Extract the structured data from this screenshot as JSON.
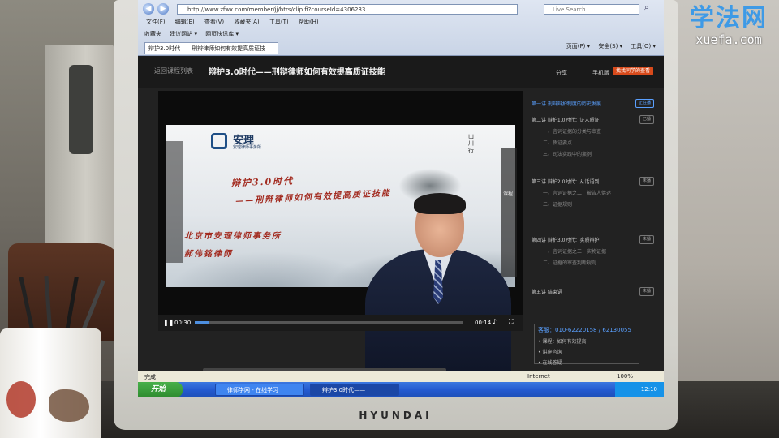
{
  "watermark": {
    "main": "学法网",
    "sub": "xuefa.com"
  },
  "monitor": {
    "brand": "HYUNDAI"
  },
  "browser": {
    "address": "http://www.zfwx.com/member/jj/btrs/clip.fi?courseId=4306233",
    "search_placeholder": "Live Search",
    "menu": [
      "文件(F)",
      "编辑(E)",
      "查看(V)",
      "收藏夹(A)",
      "工具(T)",
      "帮助(H)"
    ],
    "favorites": [
      "收藏夹",
      "建议网站 ▾",
      "网页快讯库 ▾"
    ],
    "tab_title": "辩护3.0时代——刑辩律师如何有效提高质证技",
    "commands": [
      "页面(P) ▾",
      "安全(S) ▾",
      "工具(O) ▾"
    ]
  },
  "page": {
    "return_link": "返回课程列表",
    "title": "辩护3.0时代——刑辩律师如何有效提高质证技能",
    "share": "分享",
    "mobile": "手机版",
    "find_button": "找找同学的查看"
  },
  "video": {
    "logo_name": "安理",
    "logo_sub": "安理律师事务所",
    "seal": "山川行",
    "slide_line1": "辩护3.0时代",
    "slide_line2": "——刑辩律师如何有效提高质证技能",
    "slide_line3": "北京市安理律师事务所",
    "slide_line4": "郝伟铭律师",
    "side_label": "课程",
    "time_current": "00:30",
    "time_total": "00:14",
    "progress_fraction": 0.05
  },
  "chapters": [
    {
      "title": "第一讲 刑辩辩护制度的历史发展",
      "badge": "正在播",
      "active": true,
      "sub": false
    },
    {
      "title": "第二讲 辩护1.0时代：证人质证",
      "badge": "已播",
      "active": false,
      "sub": false
    },
    {
      "title": "一、言词证据的分类与审查",
      "active": false,
      "sub": true
    },
    {
      "title": "二、质证要点",
      "active": false,
      "sub": true
    },
    {
      "title": "三、司法实践中的案例",
      "active": false,
      "sub": true
    },
    {
      "title": "第三讲 辩护2.0时代：从话语到",
      "badge": "未播",
      "active": false,
      "sub": false
    },
    {
      "title": "一、言词证据之二：被告人供述",
      "active": false,
      "sub": true
    },
    {
      "title": "二、证据规则",
      "active": false,
      "sub": true
    },
    {
      "title": "第四讲 辩护3.0时代：实质辩护",
      "badge": "未播",
      "active": false,
      "sub": false
    },
    {
      "title": "一、言词证据之三：实物证据",
      "active": false,
      "sub": true
    },
    {
      "title": "二、证据的审查判断规则",
      "active": false,
      "sub": true
    },
    {
      "title": "第五讲 结束语",
      "badge": "未播",
      "active": false,
      "sub": false
    }
  ],
  "contact": {
    "phone": "客服：010-62220158 / 62130055",
    "line2": "• 课程：如何有效提高",
    "line3": "• 讲座咨询",
    "line4": "• 在线答疑"
  },
  "status": {
    "left": "完成",
    "zone": "Internet",
    "zoom": "100%"
  },
  "taskbar": {
    "start": "开始",
    "tasks": [
      "律师学网 - 在线学习",
      "辩护3.0时代——"
    ],
    "clock": "12:10"
  }
}
